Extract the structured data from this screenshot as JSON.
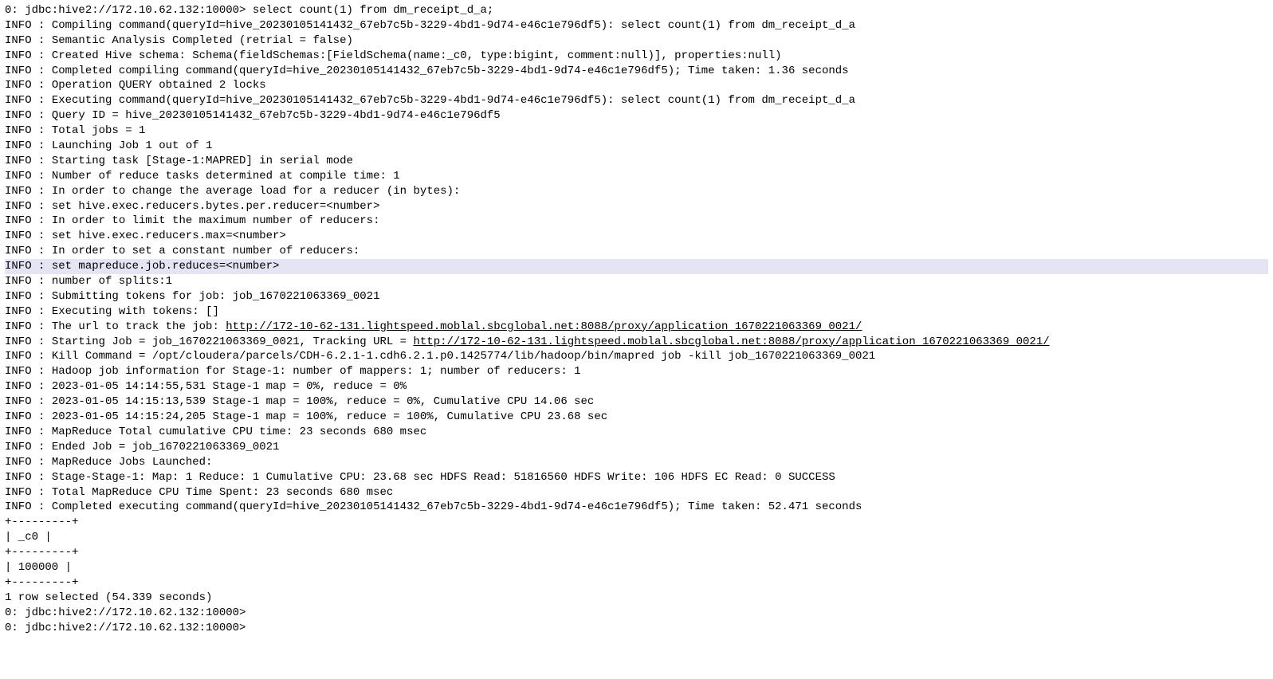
{
  "lines": [
    {
      "prefix": "0: jdbc:hive2://172.10.62.132:10000> ",
      "content": "select count(1) from dm_receipt_d_a;",
      "hasUrl": false,
      "highlighted": false
    },
    {
      "prefix": "INFO  : ",
      "content": "Compiling command(queryId=hive_20230105141432_67eb7c5b-3229-4bd1-9d74-e46c1e796df5): select count(1) from dm_receipt_d_a",
      "hasUrl": false,
      "highlighted": false
    },
    {
      "prefix": "INFO  : ",
      "content": "Semantic Analysis Completed (retrial = false)",
      "hasUrl": false,
      "highlighted": false
    },
    {
      "prefix": "INFO  : ",
      "content": "Created Hive schema: Schema(fieldSchemas:[FieldSchema(name:_c0, type:bigint, comment:null)], properties:null)",
      "hasUrl": false,
      "highlighted": false
    },
    {
      "prefix": "INFO  : ",
      "content": "Completed compiling command(queryId=hive_20230105141432_67eb7c5b-3229-4bd1-9d74-e46c1e796df5); Time taken: 1.36 seconds",
      "hasUrl": false,
      "highlighted": false
    },
    {
      "prefix": "INFO  : ",
      "content": "Operation QUERY obtained 2 locks",
      "hasUrl": false,
      "highlighted": false
    },
    {
      "prefix": "INFO  : ",
      "content": "Executing command(queryId=hive_20230105141432_67eb7c5b-3229-4bd1-9d74-e46c1e796df5): select count(1) from dm_receipt_d_a",
      "hasUrl": false,
      "highlighted": false
    },
    {
      "prefix": "INFO  : ",
      "content": "Query ID = hive_20230105141432_67eb7c5b-3229-4bd1-9d74-e46c1e796df5",
      "hasUrl": false,
      "highlighted": false
    },
    {
      "prefix": "INFO  : ",
      "content": "Total jobs = 1",
      "hasUrl": false,
      "highlighted": false
    },
    {
      "prefix": "INFO  : ",
      "content": "Launching Job 1 out of 1",
      "hasUrl": false,
      "highlighted": false
    },
    {
      "prefix": "INFO  : ",
      "content": "Starting task [Stage-1:MAPRED] in serial mode",
      "hasUrl": false,
      "highlighted": false
    },
    {
      "prefix": "INFO  : ",
      "content": "Number of reduce tasks determined at compile time: 1",
      "hasUrl": false,
      "highlighted": false
    },
    {
      "prefix": "INFO  : ",
      "content": "In order to change the average load for a reducer (in bytes):",
      "hasUrl": false,
      "highlighted": false
    },
    {
      "prefix": "INFO  : ",
      "content": "  set hive.exec.reducers.bytes.per.reducer=<number>",
      "hasUrl": false,
      "highlighted": false
    },
    {
      "prefix": "INFO  : ",
      "content": "In order to limit the maximum number of reducers:",
      "hasUrl": false,
      "highlighted": false
    },
    {
      "prefix": "INFO  : ",
      "content": "  set hive.exec.reducers.max=<number>",
      "hasUrl": false,
      "highlighted": false
    },
    {
      "prefix": "INFO  : ",
      "content": "In order to set a constant number of reducers:",
      "hasUrl": false,
      "highlighted": false
    },
    {
      "prefix": "INFO  : ",
      "content": "  set mapreduce.job.reduces=<number>",
      "hasUrl": false,
      "highlighted": true
    },
    {
      "prefix": "INFO  : ",
      "content": "number of splits:1",
      "hasUrl": false,
      "highlighted": false
    },
    {
      "prefix": "INFO  : ",
      "content": "Submitting tokens for job: job_1670221063369_0021",
      "hasUrl": false,
      "highlighted": false
    },
    {
      "prefix": "INFO  : ",
      "content": "Executing with tokens: []",
      "hasUrl": false,
      "highlighted": false
    },
    {
      "prefix": "INFO  : ",
      "content": "The url to track the job: ",
      "url": "http://172-10-62-131.lightspeed.moblal.sbcglobal.net:8088/proxy/application_1670221063369_0021/",
      "hasUrl": true,
      "highlighted": false
    },
    {
      "prefix": "INFO  : ",
      "content": "Starting Job = job_1670221063369_0021, Tracking URL = ",
      "url": "http://172-10-62-131.lightspeed.moblal.sbcglobal.net:8088/proxy/application_1670221063369_0021/",
      "hasUrl": true,
      "highlighted": false
    },
    {
      "prefix": "INFO  : ",
      "content": "Kill Command = /opt/cloudera/parcels/CDH-6.2.1-1.cdh6.2.1.p0.1425774/lib/hadoop/bin/mapred job  -kill job_1670221063369_0021",
      "hasUrl": false,
      "highlighted": false
    },
    {
      "prefix": "INFO  : ",
      "content": "Hadoop job information for Stage-1: number of mappers: 1; number of reducers: 1",
      "hasUrl": false,
      "highlighted": false
    },
    {
      "prefix": "INFO  : ",
      "content": "2023-01-05 14:14:55,531 Stage-1 map = 0%,  reduce = 0%",
      "hasUrl": false,
      "highlighted": false
    },
    {
      "prefix": "INFO  : ",
      "content": "2023-01-05 14:15:13,539 Stage-1 map = 100%,  reduce = 0%, Cumulative CPU 14.06 sec",
      "hasUrl": false,
      "highlighted": false
    },
    {
      "prefix": "INFO  : ",
      "content": "2023-01-05 14:15:24,205 Stage-1 map = 100%,  reduce = 100%, Cumulative CPU 23.68 sec",
      "hasUrl": false,
      "highlighted": false
    },
    {
      "prefix": "INFO  : ",
      "content": "MapReduce Total cumulative CPU time: 23 seconds 680 msec",
      "hasUrl": false,
      "highlighted": false
    },
    {
      "prefix": "INFO  : ",
      "content": "Ended Job = job_1670221063369_0021",
      "hasUrl": false,
      "highlighted": false
    },
    {
      "prefix": "INFO  : ",
      "content": "MapReduce Jobs Launched:",
      "hasUrl": false,
      "highlighted": false
    },
    {
      "prefix": "INFO  : ",
      "content": "Stage-Stage-1: Map: 1  Reduce: 1   Cumulative CPU: 23.68 sec   HDFS Read: 51816560 HDFS Write: 106 HDFS EC Read: 0 SUCCESS",
      "hasUrl": false,
      "highlighted": false
    },
    {
      "prefix": "INFO  : ",
      "content": "Total MapReduce CPU Time Spent: 23 seconds 680 msec",
      "hasUrl": false,
      "highlighted": false
    },
    {
      "prefix": "INFO  : ",
      "content": "Completed executing command(queryId=hive_20230105141432_67eb7c5b-3229-4bd1-9d74-e46c1e796df5); Time taken: 52.471 seconds",
      "hasUrl": false,
      "highlighted": false
    },
    {
      "prefix": "",
      "content": "+---------+",
      "hasUrl": false,
      "highlighted": false
    },
    {
      "prefix": "",
      "content": "|   _c0   |",
      "hasUrl": false,
      "highlighted": false
    },
    {
      "prefix": "",
      "content": "+---------+",
      "hasUrl": false,
      "highlighted": false
    },
    {
      "prefix": "",
      "content": "| 100000  |",
      "hasUrl": false,
      "highlighted": false
    },
    {
      "prefix": "",
      "content": "+---------+",
      "hasUrl": false,
      "highlighted": false
    },
    {
      "prefix": "",
      "content": "1 row selected (54.339 seconds)",
      "hasUrl": false,
      "highlighted": false
    },
    {
      "prefix": "",
      "content": "0: jdbc:hive2://172.10.62.132:10000>",
      "hasUrl": false,
      "highlighted": false
    },
    {
      "prefix": "",
      "content": "0: jdbc:hive2://172.10.62.132:10000>",
      "hasUrl": false,
      "highlighted": false
    }
  ]
}
